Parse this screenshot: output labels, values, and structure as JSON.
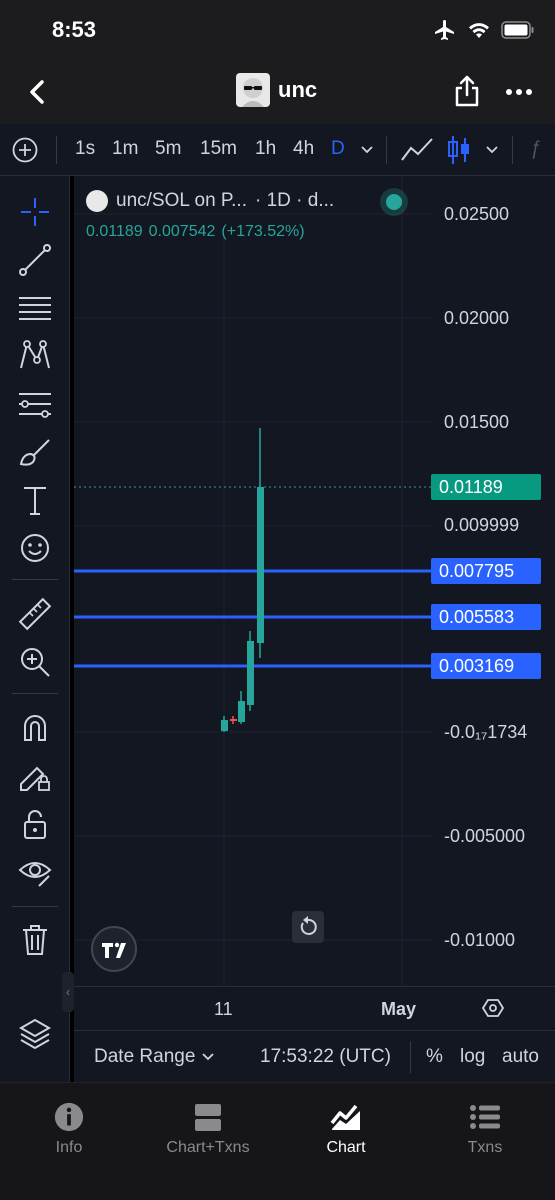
{
  "status": {
    "time": "8:53"
  },
  "header": {
    "title": "unc"
  },
  "toolbar": {
    "intervals": [
      "1s",
      "1m",
      "5m",
      "15m",
      "1h",
      "4h",
      "D"
    ],
    "active_interval": "D"
  },
  "chart": {
    "symbol": "unc/SOL on P...",
    "interval_label": "· 1D · d...",
    "last_price": "0.01189",
    "change_abs": "0.007542",
    "change_pct": "(+173.52%)",
    "axis_labels": [
      "0.02500",
      "0.02000",
      "0.01500",
      "0.009999",
      "-0.0₁₇1734",
      "-0.005000",
      "-0.01000"
    ],
    "price_tags": {
      "current": "0.01189",
      "line1": "0.007795",
      "line2": "0.005583",
      "line3": "0.003169"
    },
    "time_labels": [
      "11",
      "May"
    ],
    "colors": {
      "up": "#26a69a",
      "down": "#ef5350",
      "line": "#2962ff",
      "background": "#131722"
    }
  },
  "bottom_bar": {
    "date_range": "Date Range",
    "clock": "17:53:22 (UTC)",
    "percent": "%",
    "log": "log",
    "auto": "auto"
  },
  "tabs": [
    {
      "label": "Info",
      "icon": "info-icon"
    },
    {
      "label": "Chart+Txns",
      "icon": "split-icon"
    },
    {
      "label": "Chart",
      "icon": "chart-icon"
    },
    {
      "label": "Txns",
      "icon": "list-icon"
    }
  ]
}
